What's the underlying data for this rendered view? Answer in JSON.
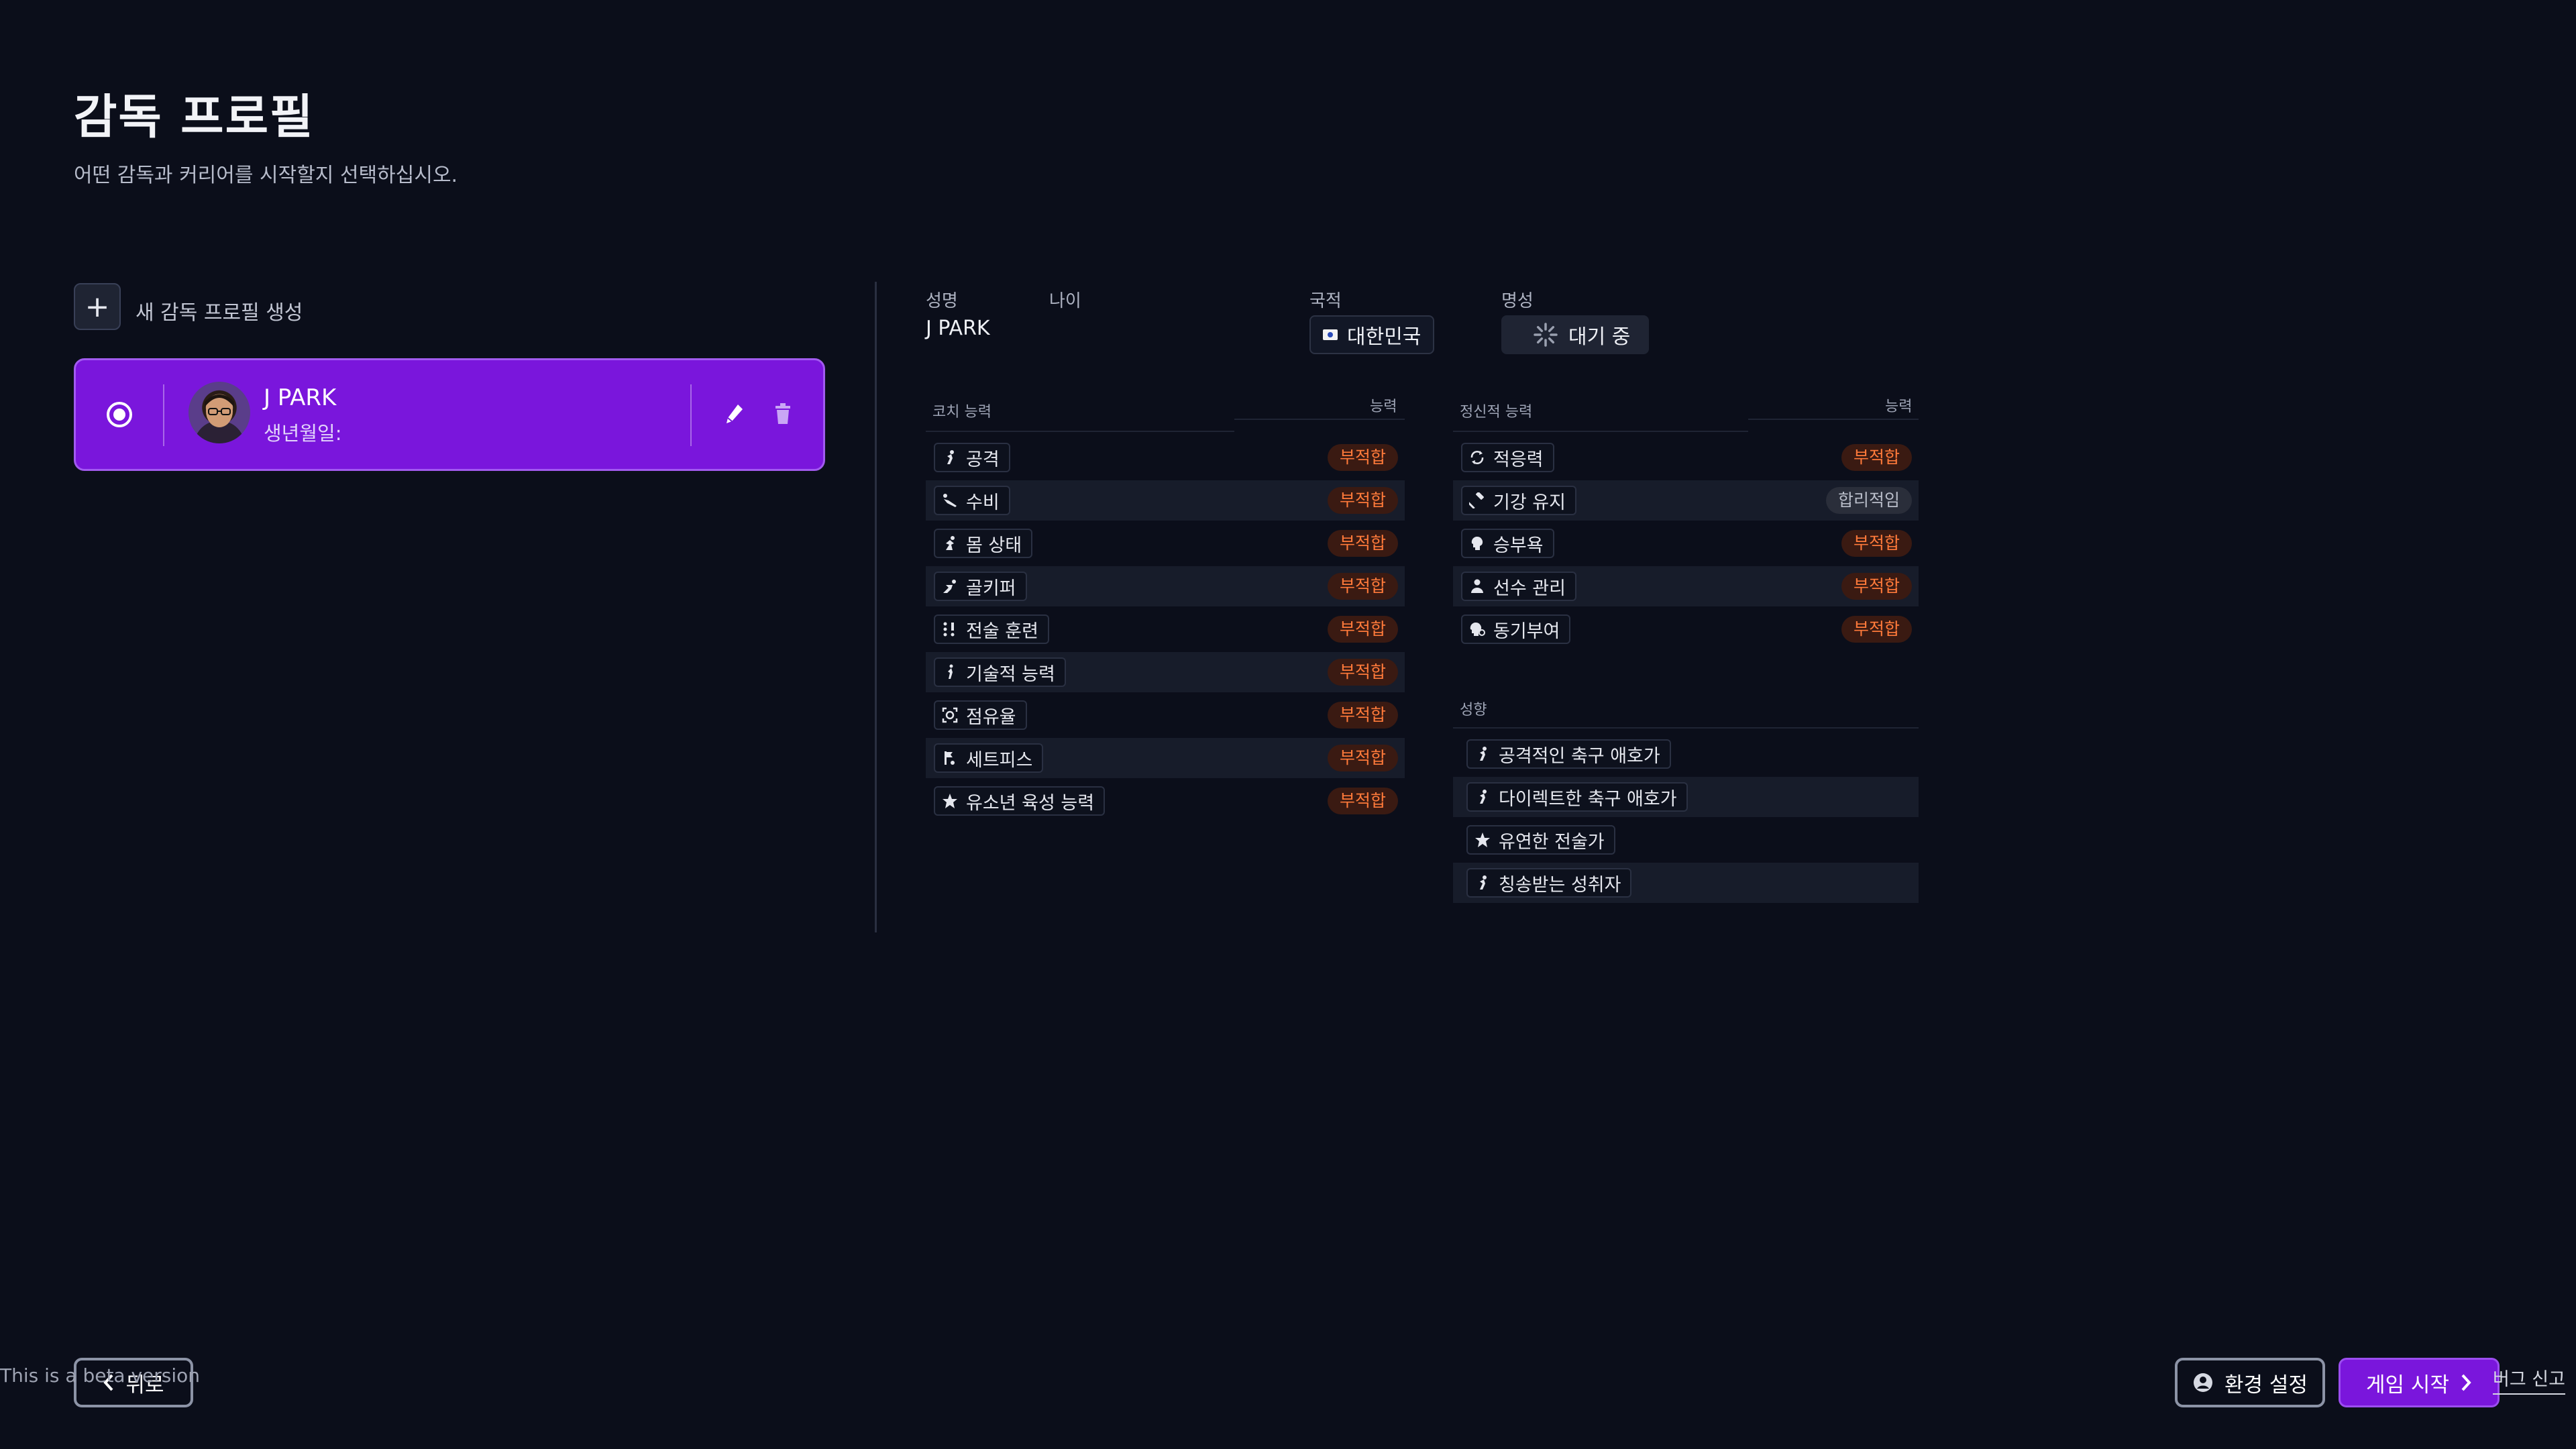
{
  "page": {
    "title": "감독 프로필",
    "subtitle": "어떤 감독과 커리어를 시작할지 선택하십시오."
  },
  "new_profile": {
    "plus": "+",
    "label": "새 감독 프로필 생성"
  },
  "profiles": [
    {
      "name": "J  PARK",
      "dob_label": "생년월일:",
      "selected": true
    }
  ],
  "header": {
    "name_label": "성명",
    "name_value": "J  PARK",
    "age_label": "나이",
    "nationality_label": "국적",
    "nationality_value": "대한민국",
    "reputation_label": "명성",
    "reputation_value": "대기 중"
  },
  "coaching": {
    "section_label": "코치 능력",
    "col_label": "능력",
    "rows": [
      {
        "label": "공격",
        "rating": "부적합",
        "icon": "attack-icon"
      },
      {
        "label": "수비",
        "rating": "부적합",
        "icon": "defense-icon"
      },
      {
        "label": "몸 상태",
        "rating": "부적합",
        "icon": "fitness-icon"
      },
      {
        "label": "골키퍼",
        "rating": "부적합",
        "icon": "goalkeeper-icon"
      },
      {
        "label": "전술 훈련",
        "rating": "부적합",
        "icon": "tactics-icon"
      },
      {
        "label": "기술적 능력",
        "rating": "부적합",
        "icon": "technical-icon"
      },
      {
        "label": "점유율",
        "rating": "부적합",
        "icon": "possession-icon"
      },
      {
        "label": "세트피스",
        "rating": "부적합",
        "icon": "set-piece-icon"
      },
      {
        "label": "유소년 육성 능력",
        "rating": "부적합",
        "icon": "star-icon"
      }
    ]
  },
  "mental": {
    "section_label": "정신적 능력",
    "col_label": "능력",
    "rows": [
      {
        "label": "적응력",
        "rating": "부적합",
        "icon": "adapt-icon"
      },
      {
        "label": "기강 유지",
        "rating": "합리적임",
        "icon": "gavel-icon"
      },
      {
        "label": "승부욕",
        "rating": "부적합",
        "icon": "head-icon"
      },
      {
        "label": "선수 관리",
        "rating": "부적합",
        "icon": "person-icon"
      },
      {
        "label": "동기부여",
        "rating": "부적합",
        "icon": "motivation-icon"
      }
    ]
  },
  "traits": {
    "section_label": "성향",
    "rows": [
      {
        "label": "공격적인 축구 애호가"
      },
      {
        "label": "다이렉트한 축구 애호가"
      },
      {
        "label": "유연한 전술가"
      },
      {
        "label": "칭송받는 성취자"
      }
    ]
  },
  "footer": {
    "back_label": "뒤로",
    "settings_label": "환경 설정",
    "start_label": "게임 시작",
    "beta_notice": "This is a beta version",
    "bug_report": "버그 신고"
  },
  "colors": {
    "background": "#0b0e1a",
    "accent": "#7a16dc",
    "bad_rating": "#ff7a3a"
  }
}
